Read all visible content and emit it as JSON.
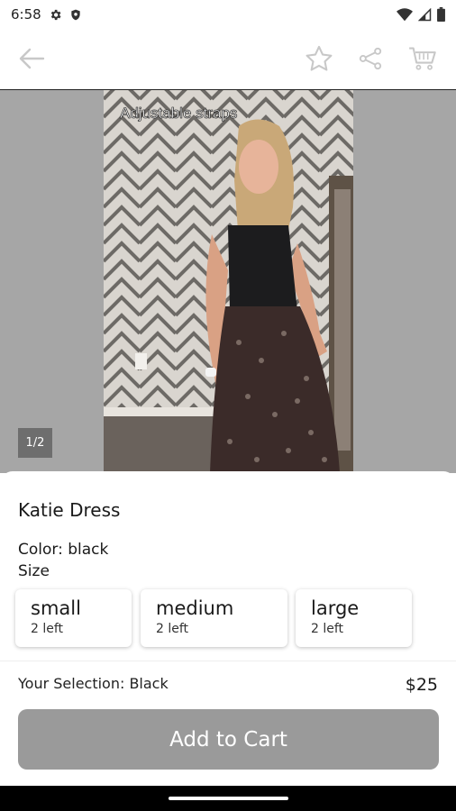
{
  "status_bar": {
    "time": "6:58"
  },
  "media": {
    "caption": "Adjustable straps",
    "page_indicator": "1/2"
  },
  "product": {
    "title": "Katie Dress",
    "color_line": "Color: black",
    "size_label": "Size",
    "sizes": [
      {
        "name": "small",
        "stock": "2 left"
      },
      {
        "name": "medium",
        "stock": "2 left"
      },
      {
        "name": "large",
        "stock": "2 left"
      }
    ],
    "selection": "Your Selection: Black",
    "price": "$25",
    "add_to_cart_label": "Add to Cart"
  },
  "colors": {
    "button_disabled": "#9a9a9a",
    "media_background": "#a6a6a6"
  }
}
